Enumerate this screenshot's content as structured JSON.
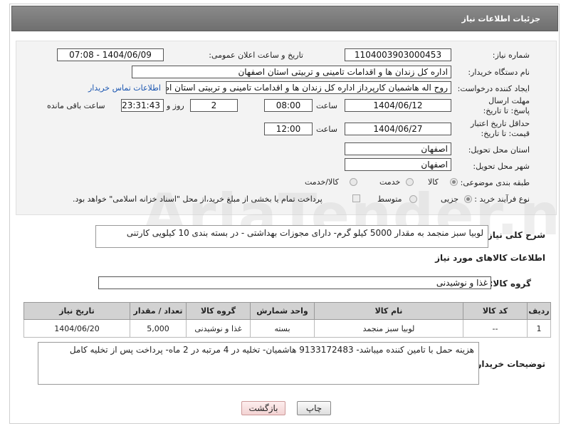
{
  "header": {
    "title": "جزئیات اطلاعات نیاز"
  },
  "watermark": {
    "text": "AriaTender.neT"
  },
  "form": {
    "need_number": {
      "label": "شماره نیاز:",
      "value": "1104003903000453"
    },
    "announce": {
      "label": "تاریخ و ساعت اعلان عمومی:",
      "value": "1404/06/09 - 07:08"
    },
    "buyer": {
      "label": "نام دستگاه خریدار:",
      "value": "اداره کل زندان ها و اقدامات تامینی و تربیتی استان اصفهان"
    },
    "requester": {
      "label": "ایجاد کننده درخواست:",
      "value": "روح اله هاشمیان کارپرداز اداره کل زندان ها و اقدامات تامینی و تربیتی استان اصفهان",
      "contact_link": "اطلاعات تماس خریدار"
    },
    "deadline": {
      "label": "مهلت ارسال پاسخ: تا تاریخ:",
      "date": "1404/06/12",
      "time_label": "ساعت",
      "time": "08:00",
      "days": "2",
      "days_label": "روز و",
      "remaining": "23:31:43",
      "remaining_label": "ساعت باقی مانده"
    },
    "validity": {
      "label": "حداقل تاریخ اعتبار قیمت: تا تاریخ:",
      "date": "1404/06/27",
      "time_label": "ساعت",
      "time": "12:00"
    },
    "province": {
      "label": "استان محل تحویل:",
      "value": "اصفهان"
    },
    "city": {
      "label": "شهر محل تحویل:",
      "value": "اصفهان"
    },
    "category": {
      "label": "طبقه بندی موضوعی:",
      "options": [
        "کالا",
        "خدمت",
        "کالا/خدمت"
      ],
      "selected": "کالا"
    },
    "process": {
      "label": "نوع فرآیند خرید :",
      "options": [
        "جزیی",
        "متوسط"
      ],
      "selected": "جزیی",
      "payment_note": "پرداخت تمام یا بخشی از مبلغ خرید،از محل \"اسناد خزانه اسلامی\" خواهد بود."
    }
  },
  "summary": {
    "label": "شرح کلی نیاز:",
    "value": "لوبیا سبز منجمد به مقدار 5000 کیلو گرم- دارای مجوزات بهداشتی - در بسته بندی 10 کیلویی کارتنی"
  },
  "goods_section": {
    "title": "اطلاعات کالاهای مورد نیاز",
    "group_label": "گروه کالا:",
    "group_value": "غذا و نوشیدنی"
  },
  "table": {
    "headers": [
      "ردیف",
      "کد کالا",
      "نام کالا",
      "واحد شمارش",
      "گروه کالا",
      "تعداد / مقدار",
      "تاریخ نیاز"
    ],
    "rows": [
      [
        "1",
        "--",
        "لوبیا سبز منجمد",
        "بسته",
        "غذا و نوشیدنی",
        "5,000",
        "1404/06/20"
      ]
    ]
  },
  "buyer_notes": {
    "label": "توضیحات خریدار:",
    "value": "هزینه حمل با تامین کننده میباشد- 9133172483 هاشمیان- تخلیه در 4 مرتبه در 2 ماه- پرداخت پس از تخلیه کامل"
  },
  "buttons": {
    "print": "چاپ",
    "back": "بازگشت"
  }
}
